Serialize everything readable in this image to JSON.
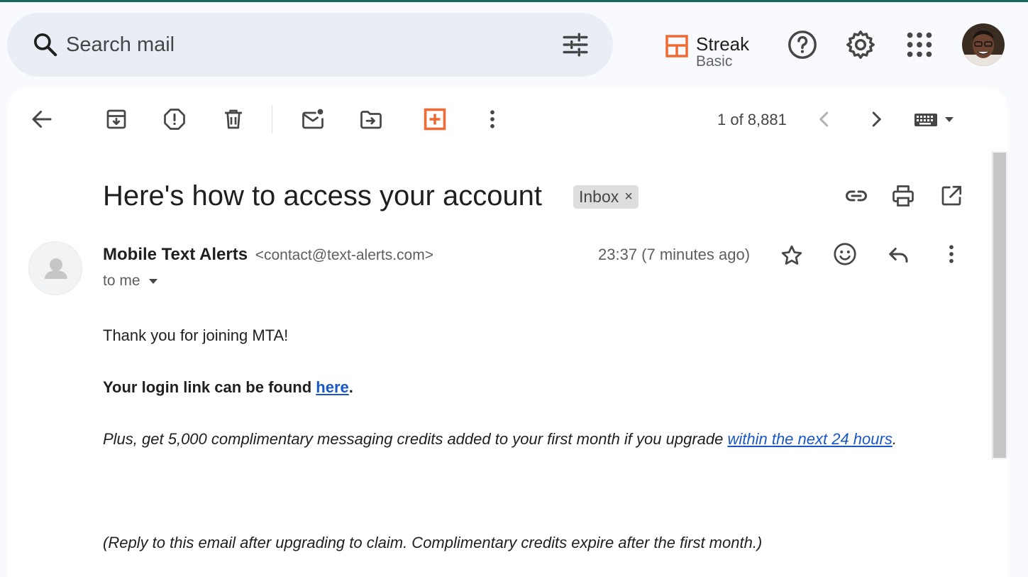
{
  "header": {
    "search_placeholder": "Search mail",
    "streak_name": "Streak",
    "streak_plan": "Basic"
  },
  "colors": {
    "accent_bar": "#1a6b5e",
    "streak_orange": "#f06a35",
    "link_blue": "#1a57c6"
  },
  "toolbar": {
    "pager": "1 of 8,881"
  },
  "email": {
    "subject": "Here's how to access your account",
    "label": "Inbox",
    "label_remove": "×",
    "sender_name": "Mobile Text Alerts",
    "sender_email": "<contact@text-alerts.com>",
    "recipient": "to me",
    "timestamp": "23:37 (7 minutes ago)",
    "body": {
      "p1": "Thank you for joining MTA!",
      "p2_prefix": "Your login link can be found ",
      "p2_link": "here",
      "p2_suffix": ".",
      "p3_prefix": "Plus, get 5,000 complimentary messaging credits added to your first month if you upgrade ",
      "p3_link": "within the next 24 hours",
      "p3_suffix": ".",
      "p4": "(Reply to this email after upgrading to claim. Complimentary credits expire after the first month.)"
    }
  }
}
